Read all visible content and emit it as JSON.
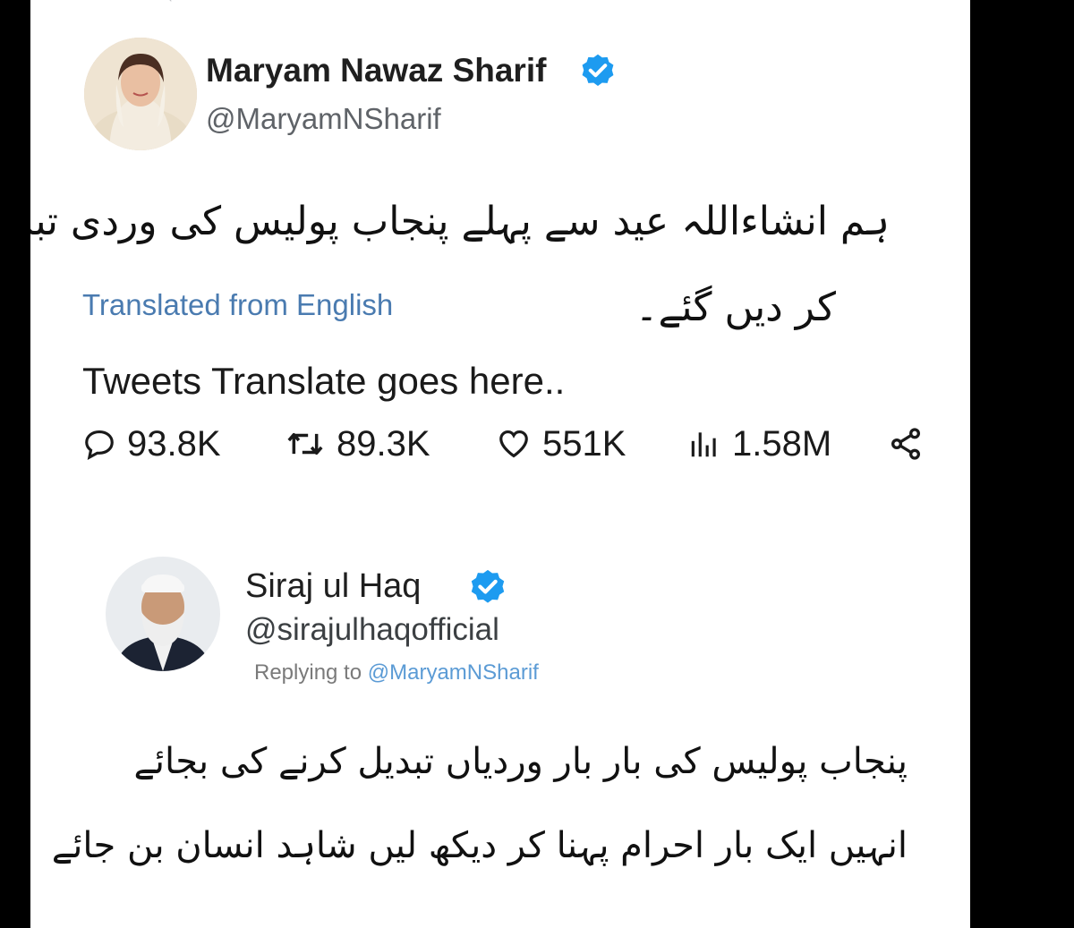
{
  "tweet1": {
    "name": "Maryam Nawaz Sharif",
    "handle": "@MaryamNSharif",
    "text_line1": "ہم انشاءاللہ عید سے پہلے پنجاب پولیس کی وردی تبدیل",
    "text_line2": "کر دیں گئے۔",
    "translated_label": "Translated from English",
    "translation": "Tweets Translate goes here..",
    "replies": "93.8K",
    "retweets": "89.3K",
    "likes": "551K",
    "views": "1.58M"
  },
  "tweet2": {
    "name": "Siraj ul Haq",
    "handle": "@sirajulhaqofficial",
    "replying_prefix": "Replying to",
    "replying_mention": "@MaryamNSharif",
    "text_line1": "پنجاب پولیس کی بار بار وردیاں تبدیل کرنے کی بجائے",
    "text_line2": "انہیں ایک بار احرام پہنا کر دیکھ لیں شاہد انسان بن جائے"
  },
  "colors": {
    "verified": "#1d9bf0",
    "link": "#4a7bb0",
    "text": "#1a1a1a",
    "muted": "#5f6368"
  },
  "icons": [
    "retweet-icon",
    "verified-badge-icon",
    "reply-icon",
    "like-icon",
    "views-icon",
    "share-icon"
  ]
}
